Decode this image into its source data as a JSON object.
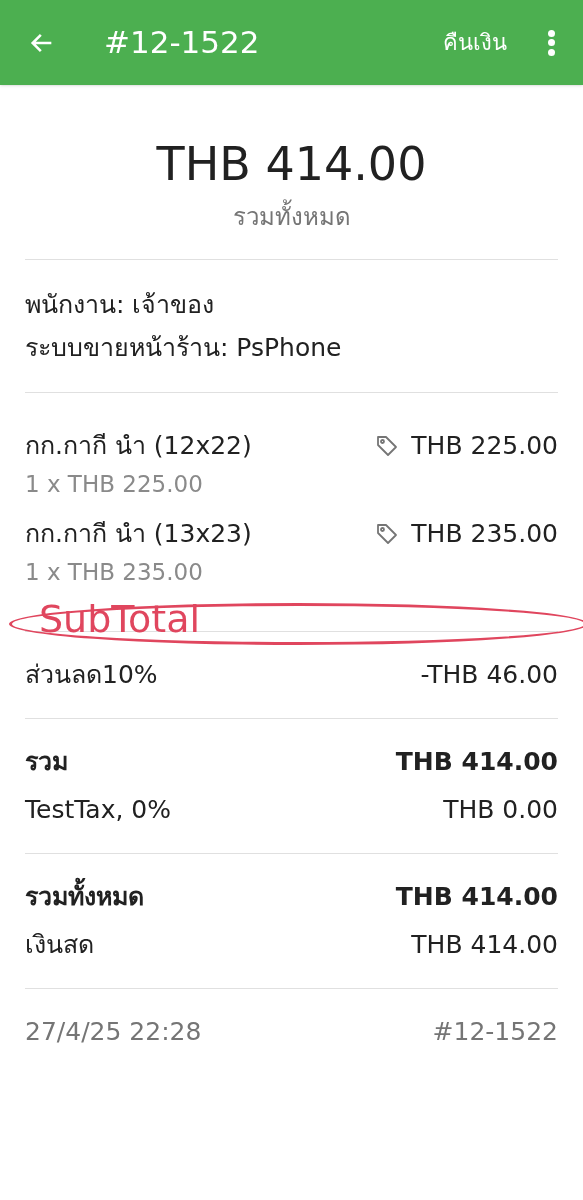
{
  "header": {
    "title": "#12-1522",
    "action": "คืนเงิน"
  },
  "summary": {
    "amount": "THB 414.00",
    "label": "รวมทั้งหมด"
  },
  "info": [
    "พนักงาน: เจ้าของ",
    "ระบบขายหน้าร้าน: PsPhone"
  ],
  "items": [
    {
      "name": "กก.กากี นำ (12x22)",
      "price": "THB 225.00",
      "detail": "1 x THB 225.00"
    },
    {
      "name": "กก.กากี นำ (13x23)",
      "price": "THB 235.00",
      "detail": "1 x THB 235.00"
    }
  ],
  "annotation": {
    "text": "SubTotal"
  },
  "sections": [
    [
      {
        "label": "ส่วนลด10%",
        "amount": "-THB 46.00",
        "bold": false
      }
    ],
    [
      {
        "label": "รวม",
        "amount": "THB 414.00",
        "bold": true
      },
      {
        "label": "TestTax, 0%",
        "amount": "THB 0.00",
        "bold": false
      }
    ],
    [
      {
        "label": "รวมทั้งหมด",
        "amount": "THB 414.00",
        "bold": true
      },
      {
        "label": "เงินสด",
        "amount": "THB 414.00",
        "bold": false
      }
    ]
  ],
  "footer": {
    "datetime": "27/4/25 22:28",
    "receipt": "#12-1522"
  }
}
